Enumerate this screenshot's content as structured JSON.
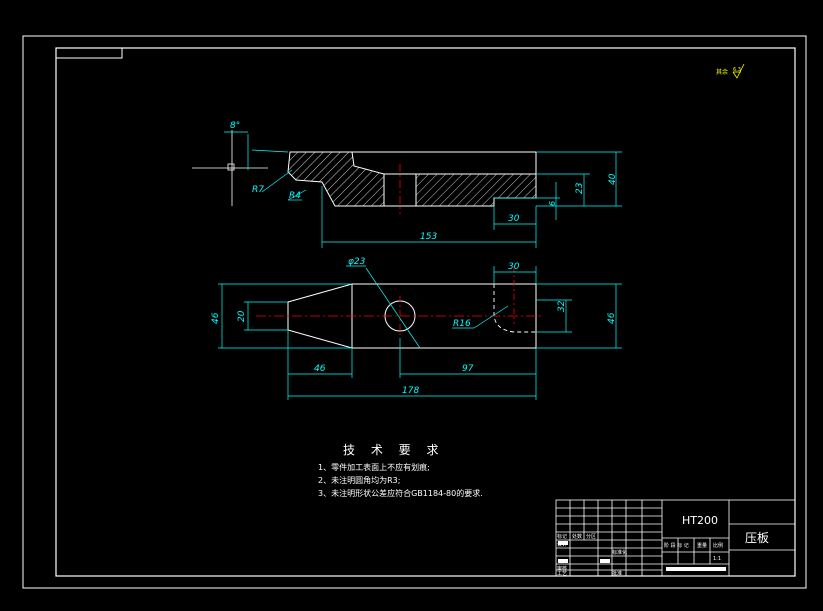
{
  "colors": {
    "background": "#000000",
    "frame": "#ffffff",
    "dimension": "#00ffff",
    "centerline": "#ff0000",
    "hatch": "#ffffff",
    "roughness": "#ffff00"
  },
  "roughness_note": {
    "label": "其余",
    "value": "6.3"
  },
  "front_view": {
    "dims": {
      "angle": "8°",
      "r7": "R7",
      "r4": "R4",
      "d23": "23",
      "d40": "40",
      "d6": "6",
      "d30": "30",
      "d153": "153"
    }
  },
  "top_view": {
    "dims": {
      "hole": "φ23",
      "d30": "30",
      "d46_left": "46",
      "d20": "20",
      "r16": "R16",
      "d32": "32",
      "d46_right": "46",
      "d46_bottom": "46",
      "d97": "97",
      "d178": "178"
    }
  },
  "requirements": {
    "title": "技 术 要 求",
    "items": [
      "1、零件加工表面上不应有划痕;",
      "2、未注明圆角均为R3;",
      "3、未注明形状公差应符合GB1184-80的要求."
    ]
  },
  "title_block": {
    "material": "HT200",
    "part_name": "压板",
    "scale": "1:1",
    "labels": {
      "biaoji": "标记",
      "chushu": "处数",
      "fenqu": "分区",
      "sheji": "设计",
      "biaozhunhua": "标准化",
      "shenhe": "审核",
      "gongyi": "工艺",
      "pizhun": "批准",
      "jieduan": "阶 段 标 记",
      "zhongliang": "重量",
      "bili": "比例"
    }
  }
}
